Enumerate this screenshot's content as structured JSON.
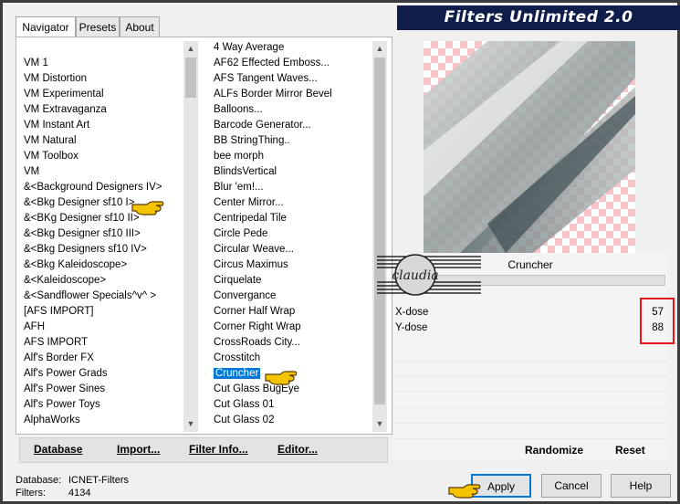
{
  "window": {
    "title": "Filters Unlimited 2.0"
  },
  "tabs": [
    {
      "label": "Navigator",
      "active": true
    },
    {
      "label": "Presets",
      "active": false
    },
    {
      "label": "About",
      "active": false
    }
  ],
  "categories": [
    "VM 1",
    "VM Distortion",
    "VM Experimental",
    "VM Extravaganza",
    "VM Instant Art",
    "VM Natural",
    "VM Toolbox",
    "VM",
    "&<Background Designers IV>",
    "&<Bkg Designer sf10 I>",
    "&<BKg Designer sf10 II>",
    "&<Bkg Designer sf10 III>",
    "&<Bkg Designers sf10 IV>",
    "&<Bkg Kaleidoscope>",
    "&<Kaleidoscope>",
    "&<Sandflower Specials^v^ >",
    "[AFS IMPORT]",
    "AFH",
    "AFS IMPORT",
    "Alf's Border FX",
    "Alf's Power Grads",
    "Alf's Power Sines",
    "Alf's Power Toys",
    "AlphaWorks"
  ],
  "filters": [
    "4 Way Average",
    "AF62 Effected Emboss...",
    "AFS Tangent Waves...",
    "ALFs Border Mirror Bevel",
    "Balloons...",
    "Barcode Generator...",
    "BB StringThing..",
    "bee morph",
    "BlindsVertical",
    "Blur 'em!...",
    "Center Mirror...",
    "Centripedal Tile",
    "Circle Pede",
    "Circular Weave...",
    "Circus Maximus",
    "Cirquelate",
    "Convergance",
    "Corner Half Wrap",
    "Corner Right Wrap",
    "CrossRoads City...",
    "Crosstitch",
    "Cruncher",
    "Cut Glass  BugEye",
    "Cut Glass 01",
    "Cut Glass 02"
  ],
  "selected_filter": "Cruncher",
  "bottom_buttons": {
    "database": "Database",
    "import": "Import...",
    "filter_info": "Filter Info...",
    "editor": "Editor..."
  },
  "parameters": [
    {
      "label": "X-dose",
      "value": "57"
    },
    {
      "label": "Y-dose",
      "value": "88"
    }
  ],
  "right_buttons": {
    "randomize": "Randomize",
    "reset": "Reset"
  },
  "status": {
    "database_label": "Database:",
    "database_value": "ICNET-Filters",
    "filters_label": "Filters:",
    "filters_value": "4134"
  },
  "dialog_buttons": {
    "apply": "Apply",
    "cancel": "Cancel",
    "help": "Help"
  },
  "watermark": "claudia",
  "colors": {
    "title_bg": "#0f1d4a",
    "selection": "#0078d7",
    "highlight_box": "#e3161b",
    "pointer": "#f5c400"
  }
}
